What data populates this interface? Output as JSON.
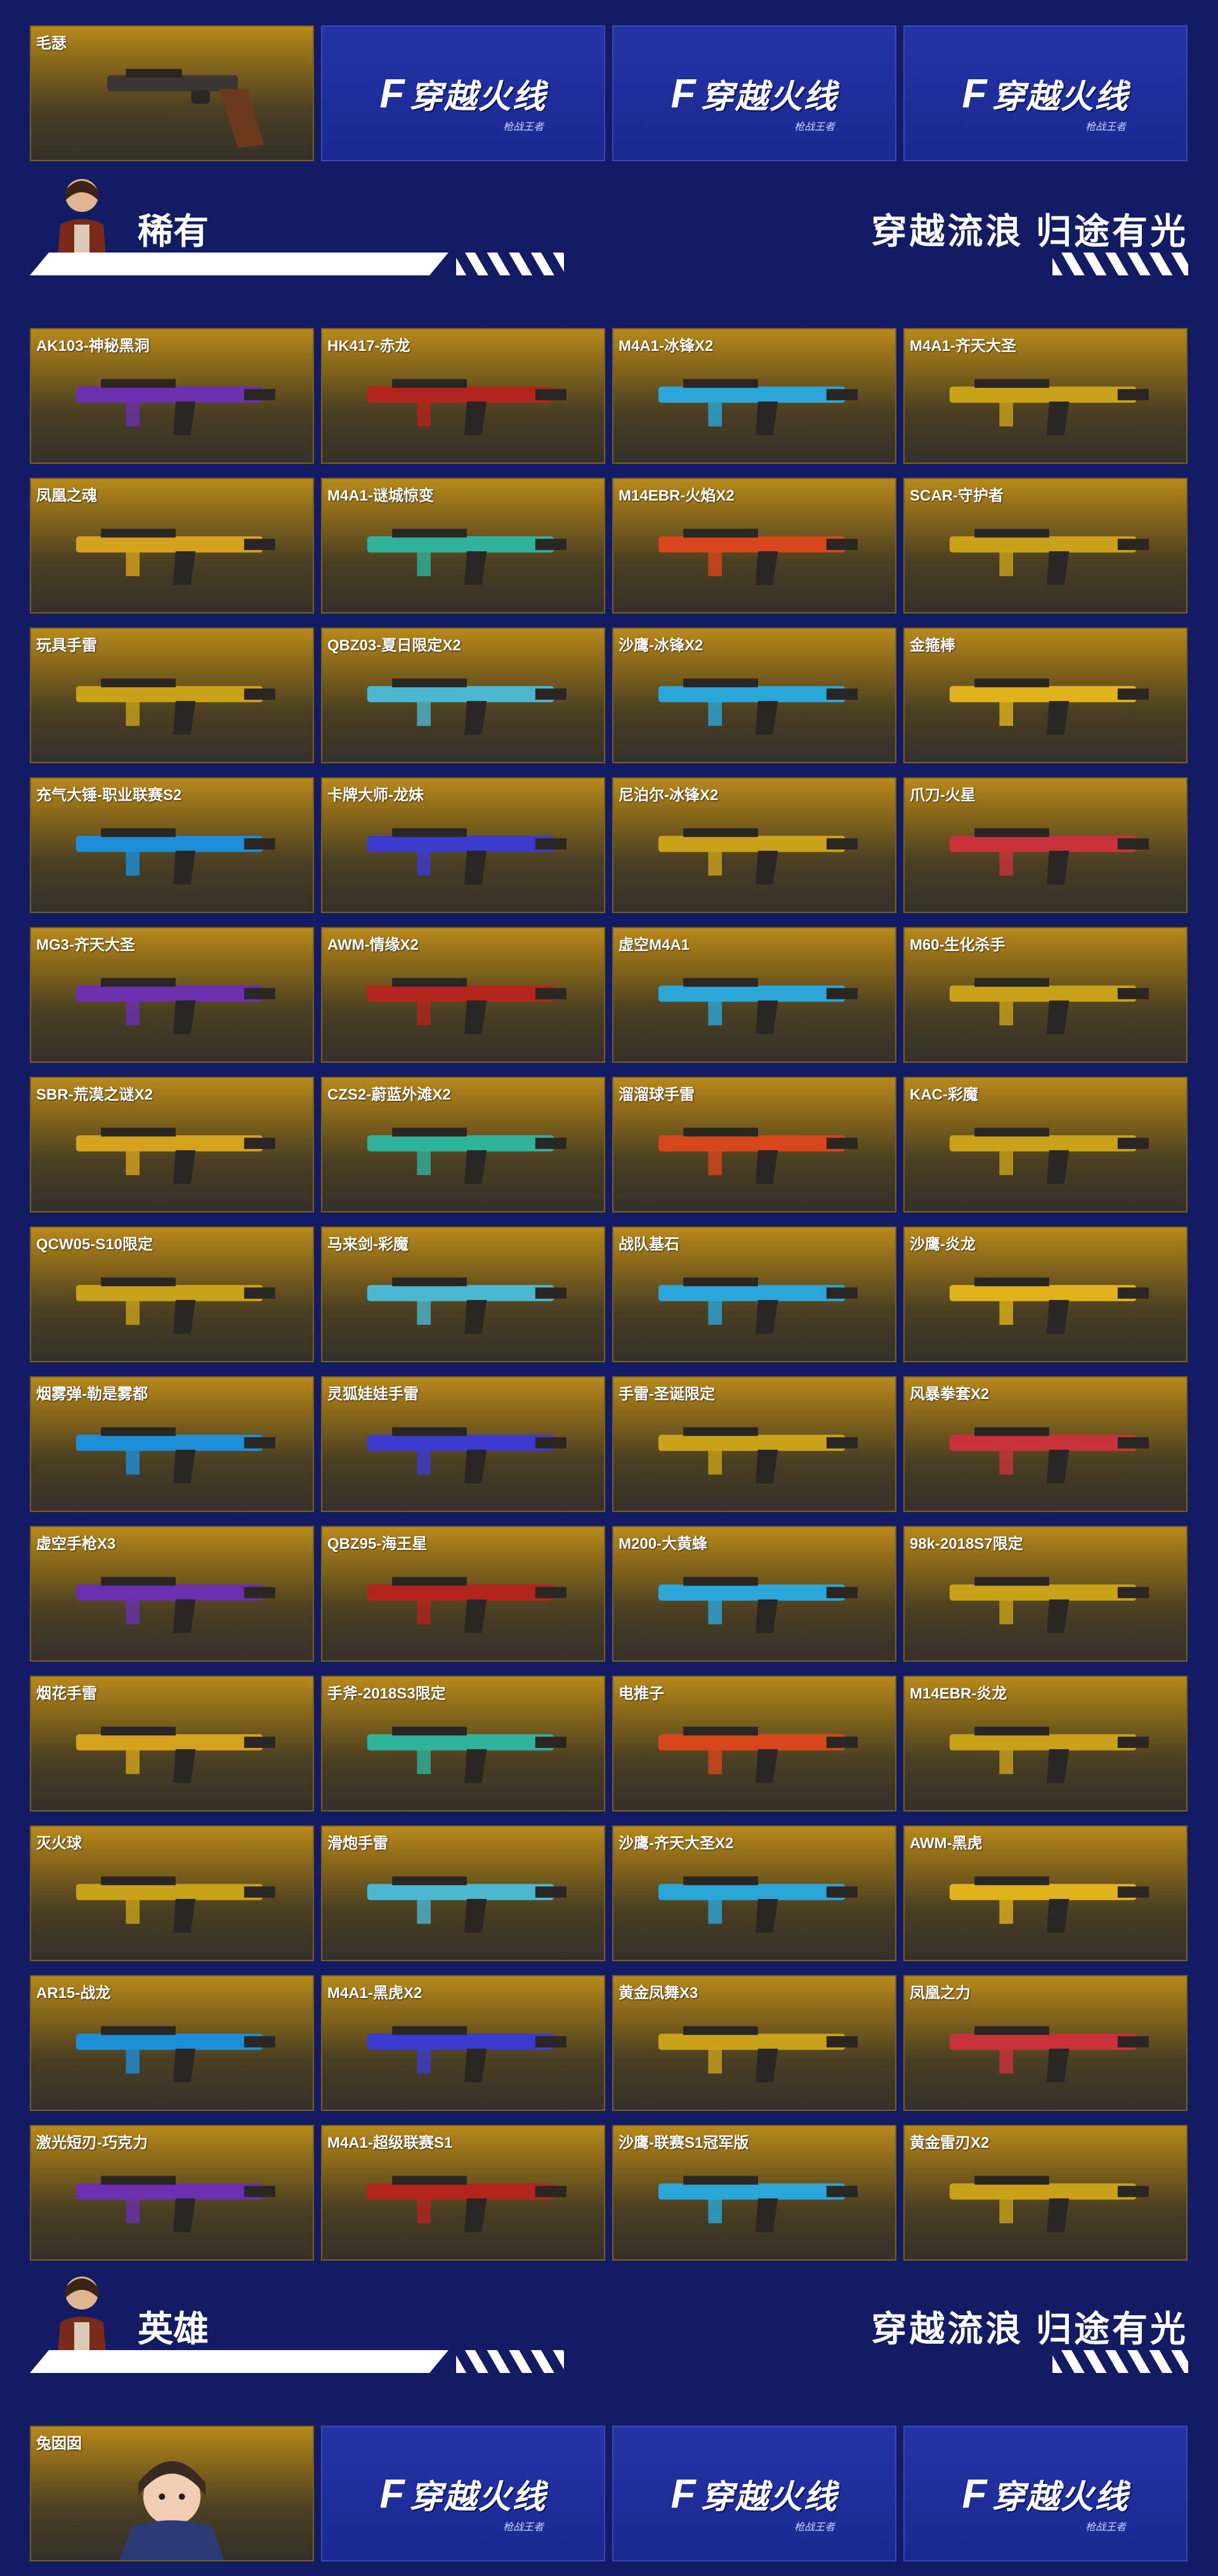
{
  "top_row": {
    "first_item": "毛瑟",
    "logo_text": "穿越火线",
    "logo_sub": "枪战王者"
  },
  "rare_section": {
    "title": "稀有",
    "slogan": "穿越流浪 归途有光"
  },
  "rare_items": [
    "AK103-神秘黑洞",
    "HK417-赤龙",
    "M4A1-冰锋X2",
    "M4A1-齐天大圣",
    "凤凰之魂",
    "M4A1-谜城惊变",
    "M14EBR-火焰X2",
    "SCAR-守护者",
    "玩具手雷",
    "QBZ03-夏日限定X2",
    "沙鹰-冰锋X2",
    "金箍棒",
    "充气大锤-职业联赛S2",
    "卡牌大师-龙妹",
    "尼泊尔-冰锋X2",
    "爪刀-火星",
    "MG3-齐天大圣",
    "AWM-情缘X2",
    "虚空M4A1",
    "M60-生化杀手",
    "SBR-荒漠之谜X2",
    "CZS2-蔚蓝外滩X2",
    "溜溜球手雷",
    "KAC-彩魔",
    "QCW05-S10限定",
    "马来剑-彩魔",
    "战队基石",
    "沙鹰-炎龙",
    "烟雾弹-勒是雾都",
    "灵狐娃娃手雷",
    "手雷-圣诞限定",
    "风暴拳套X2",
    "虚空手枪X3",
    "QBZ95-海王星",
    "M200-大黄蜂",
    "98k-2018S7限定",
    "烟花手雷",
    "手斧-2018S3限定",
    "电推子",
    "M14EBR-炎龙",
    "灭火球",
    "滑炮手雷",
    "沙鹰-齐天大圣X2",
    "AWM-黑虎",
    "AR15-战龙",
    "M4A1-黑虎X2",
    "黄金凤舞X3",
    "凤凰之力",
    "激光短刃-巧克力",
    "M4A1-超级联赛S1",
    "沙鹰-联赛S1冠军版",
    "黄金雷刃X2"
  ],
  "hero_section": {
    "title": "英雄",
    "slogan": "穿越流浪 归途有光"
  },
  "bottom_row": {
    "first_item": "兔囡囡",
    "logo_text": "穿越火线",
    "logo_sub": "枪战王者"
  },
  "colors": {
    "background": "#121b63",
    "card_gold": "#b8891b",
    "logo_blue": "#2434a6"
  }
}
